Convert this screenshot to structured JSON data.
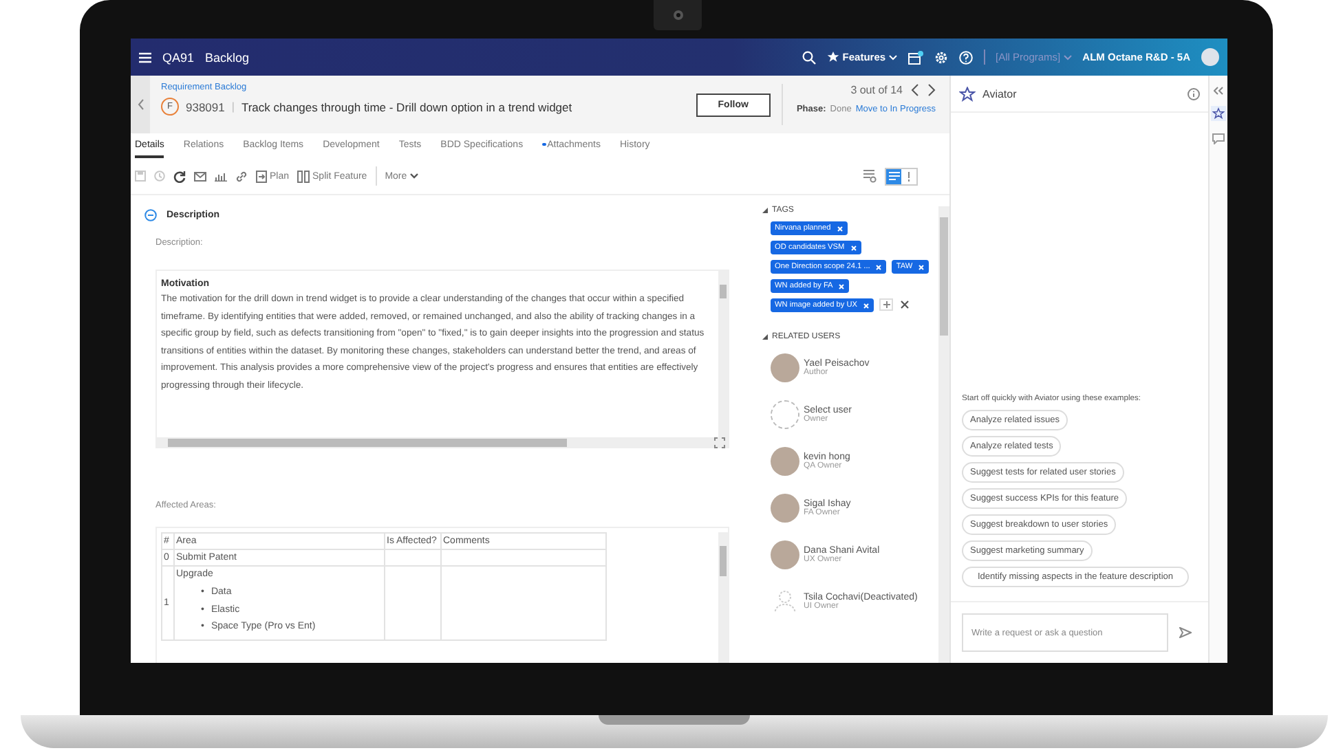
{
  "top_bar": {
    "workspace": "QA91",
    "module": "Backlog",
    "favorites": "Features",
    "calendar_notification": true,
    "program": "[All Programs]",
    "workspace_name": "ALM Octane R&D - 5A"
  },
  "header": {
    "breadcrumb": "Requirement Backlog",
    "type_badge": "F",
    "id": "938091",
    "separator": "|",
    "title": "Track changes through time - Drill down option in a trend widget",
    "follow_button": "Follow",
    "pager": "3 out of 14",
    "phase_label": "Phase:",
    "phase": "Done",
    "phase_action": "Move to In Progress"
  },
  "tabs": [
    {
      "label": "Details",
      "selected": true,
      "dot": false
    },
    {
      "label": "Relations",
      "selected": false,
      "dot": false
    },
    {
      "label": "Backlog Items",
      "selected": false,
      "dot": false
    },
    {
      "label": "Development",
      "selected": false,
      "dot": false
    },
    {
      "label": "Tests",
      "selected": false,
      "dot": false
    },
    {
      "label": "BDD Specifications",
      "selected": false,
      "dot": false
    },
    {
      "label": "Attachments",
      "selected": false,
      "dot": true
    },
    {
      "label": "History",
      "selected": false,
      "dot": false
    }
  ],
  "toolbar": {
    "save_disabled": true,
    "history_disabled": true,
    "plan": "Plan",
    "split": "Split Feature",
    "more": "More"
  },
  "view_toggle": [
    {
      "selected": true
    },
    {
      "selected": false
    }
  ],
  "description": {
    "section_title": "Description",
    "expanded": true,
    "field_label": "Description:",
    "heading": "Motivation",
    "text": "The motivation for the drill down in trend widget is to provide a clear understanding of the changes that occur within a specified timeframe. By identifying entities that were added, removed, or remained unchanged, and also the ability of tracking changes in a specific group by field, such as defects transitioning from \"open\" to \"fixed,\" is to gain deeper insights into the progression and status transitions of entities within the dataset. By monitoring these changes, stakeholders can understand better the trend, and areas of improvement. This analysis provides a more comprehensive view of the project's progress and ensures that entities are effectively progressing through their lifecycle."
  },
  "affected_areas": {
    "label": "Affected Areas:",
    "marker": "•",
    "columns": [
      "#",
      "Area",
      "Is Affected?",
      "Comments"
    ],
    "rows": [
      {
        "index": "0",
        "area": "Submit Patent"
      },
      {
        "index": "1",
        "area": "Upgrade",
        "items": [
          "Data",
          "Elastic",
          "Space Type (Pro vs Ent)"
        ]
      }
    ]
  },
  "tags": {
    "title": "TAGS",
    "items": [
      "Nirvana planned",
      "OD candidates VSM",
      "One Direction scope 24.1 ...",
      "TAW",
      "WN added by FA",
      "WN image added by UX"
    ]
  },
  "related_users": {
    "title": "RELATED USERS",
    "users": [
      {
        "name": "Yael Peisachov",
        "role": "Author",
        "kind": "photo"
      },
      {
        "name": "Select user",
        "role": "Owner",
        "kind": "empty"
      },
      {
        "name": "kevin hong",
        "role": "QA Owner",
        "kind": "photo"
      },
      {
        "name": "Sigal Ishay",
        "role": "FA Owner",
        "kind": "photo"
      },
      {
        "name": "Dana Shani Avital",
        "role": "UX Owner",
        "kind": "photo"
      },
      {
        "name": "Tsila Cochavi(Deactivated)",
        "role": "UI Owner",
        "kind": "silhouette"
      }
    ]
  },
  "aviator": {
    "title": "Aviator",
    "intro": "Start off quickly with Aviator using these examples:",
    "suggestions": [
      "Analyze related issues",
      "Analyze related tests",
      "Suggest tests for related user stories",
      "Suggest success KPIs for this feature",
      "Suggest breakdown to user stories",
      "Suggest marketing summary",
      "Identify missing aspects in the feature description"
    ],
    "input_placeholder": "Write a request or ask a question"
  },
  "side_strip": [
    {
      "kind": "aviator",
      "selected": true
    },
    {
      "kind": "comments",
      "selected": false
    }
  ]
}
